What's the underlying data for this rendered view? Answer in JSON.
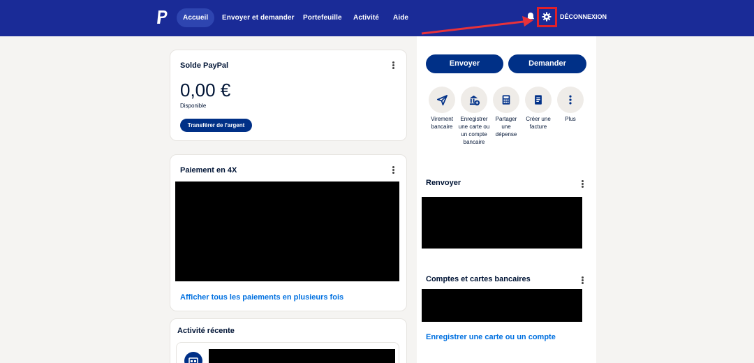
{
  "header": {
    "nav": [
      {
        "label": "Accueil",
        "active": true
      },
      {
        "label": "Envoyer et demander"
      },
      {
        "label": "Portefeuille"
      },
      {
        "label": "Activité"
      },
      {
        "label": "Aide"
      }
    ],
    "logout_label": "DÉCONNEXION",
    "icons": [
      "paypal-logo",
      "bell-icon",
      "gear-icon"
    ],
    "accent": "#1a2b97",
    "highlight_color": "#e0202a"
  },
  "balance_card": {
    "title": "Solde PayPal",
    "amount": "0,00 €",
    "subtitle": "Disponible",
    "transfer_label": "Transférer de l'argent"
  },
  "installments_card": {
    "title": "Paiement en 4X",
    "link": "Afficher tous les paiements en plusieurs fois"
  },
  "activity_card": {
    "title": "Activité récente"
  },
  "right": {
    "send_label": "Envoyer",
    "request_label": "Demander",
    "actions": [
      {
        "icon": "send-arrow-icon",
        "label": "Virement bancaire"
      },
      {
        "icon": "bank-add-icon",
        "label": "Enregistrer une carte ou un compte bancaire"
      },
      {
        "icon": "calculator-icon",
        "label": "Partager une dépense"
      },
      {
        "icon": "invoice-icon",
        "label": "Créer une facture"
      },
      {
        "icon": "more-icon",
        "label": "Plus"
      }
    ],
    "resend_title": "Renvoyer",
    "accounts_title": "Comptes et cartes bancaires",
    "accounts_link": "Enregistrer une carte ou un compte"
  }
}
